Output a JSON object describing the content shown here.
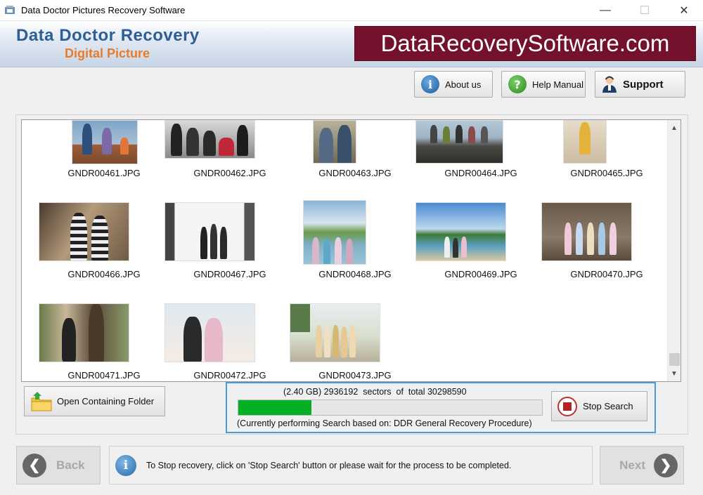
{
  "window": {
    "title": "Data Doctor Pictures Recovery Software",
    "minimize": "—",
    "maximize": "☐",
    "close": "✕"
  },
  "banner": {
    "brand_line1": "Data Doctor Recovery",
    "brand_line2": "Digital Picture",
    "site": "DataRecoverySoftware.com"
  },
  "toolbar": {
    "about_label": "About us",
    "help_label": "Help Manual",
    "support_label": "Support"
  },
  "gallery": {
    "files": [
      "GNDR00461.JPG",
      "GNDR00462.JPG",
      "GNDR00463.JPG",
      "GNDR00464.JPG",
      "GNDR00465.JPG",
      "GNDR00466.JPG",
      "GNDR00467.JPG",
      "GNDR00468.JPG",
      "GNDR00469.JPG",
      "GNDR00470.JPG",
      "GNDR00471.JPG",
      "GNDR00472.JPG",
      "GNDR00473.JPG"
    ]
  },
  "actions": {
    "open_folder_label": "Open Containing Folder",
    "stop_label": "Stop Search"
  },
  "progress": {
    "status": "(2.40 GB) 2936192  sectors  of  total 30298590",
    "fraction": 0.24,
    "procedure": "(Currently performing Search based on:  DDR General Recovery Procedure)"
  },
  "footer": {
    "back_label": "Back",
    "next_label": "Next",
    "info": "To Stop recovery, click on 'Stop Search' button or please wait for the process to be completed."
  }
}
